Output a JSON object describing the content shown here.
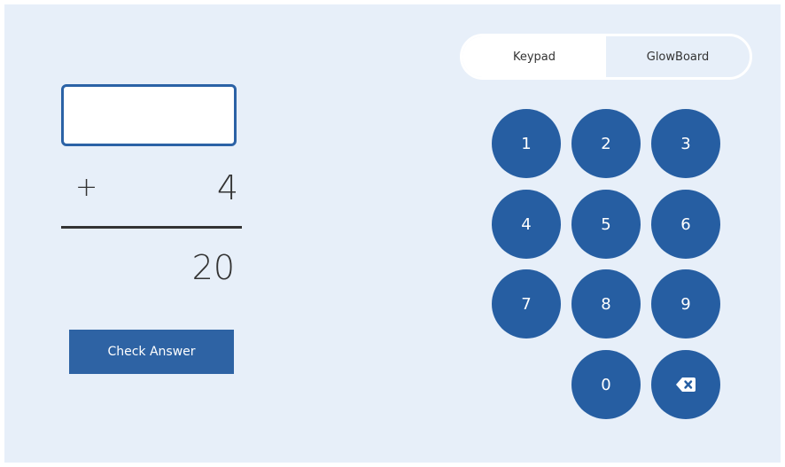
{
  "problem": {
    "answer_value": "",
    "operator": "+",
    "addend": "4",
    "sum": "20",
    "check_label": "Check Answer"
  },
  "mode_toggle": {
    "options": [
      "Keypad",
      "GlowBoard"
    ],
    "selected": "Keypad"
  },
  "keypad": {
    "keys": [
      "1",
      "2",
      "3",
      "4",
      "5",
      "6",
      "7",
      "8",
      "9",
      "0"
    ],
    "backspace_icon": "backspace-icon"
  },
  "colors": {
    "accent": "#2b62a6",
    "background": "#e7eff9",
    "key_fill": "#265ea2"
  }
}
